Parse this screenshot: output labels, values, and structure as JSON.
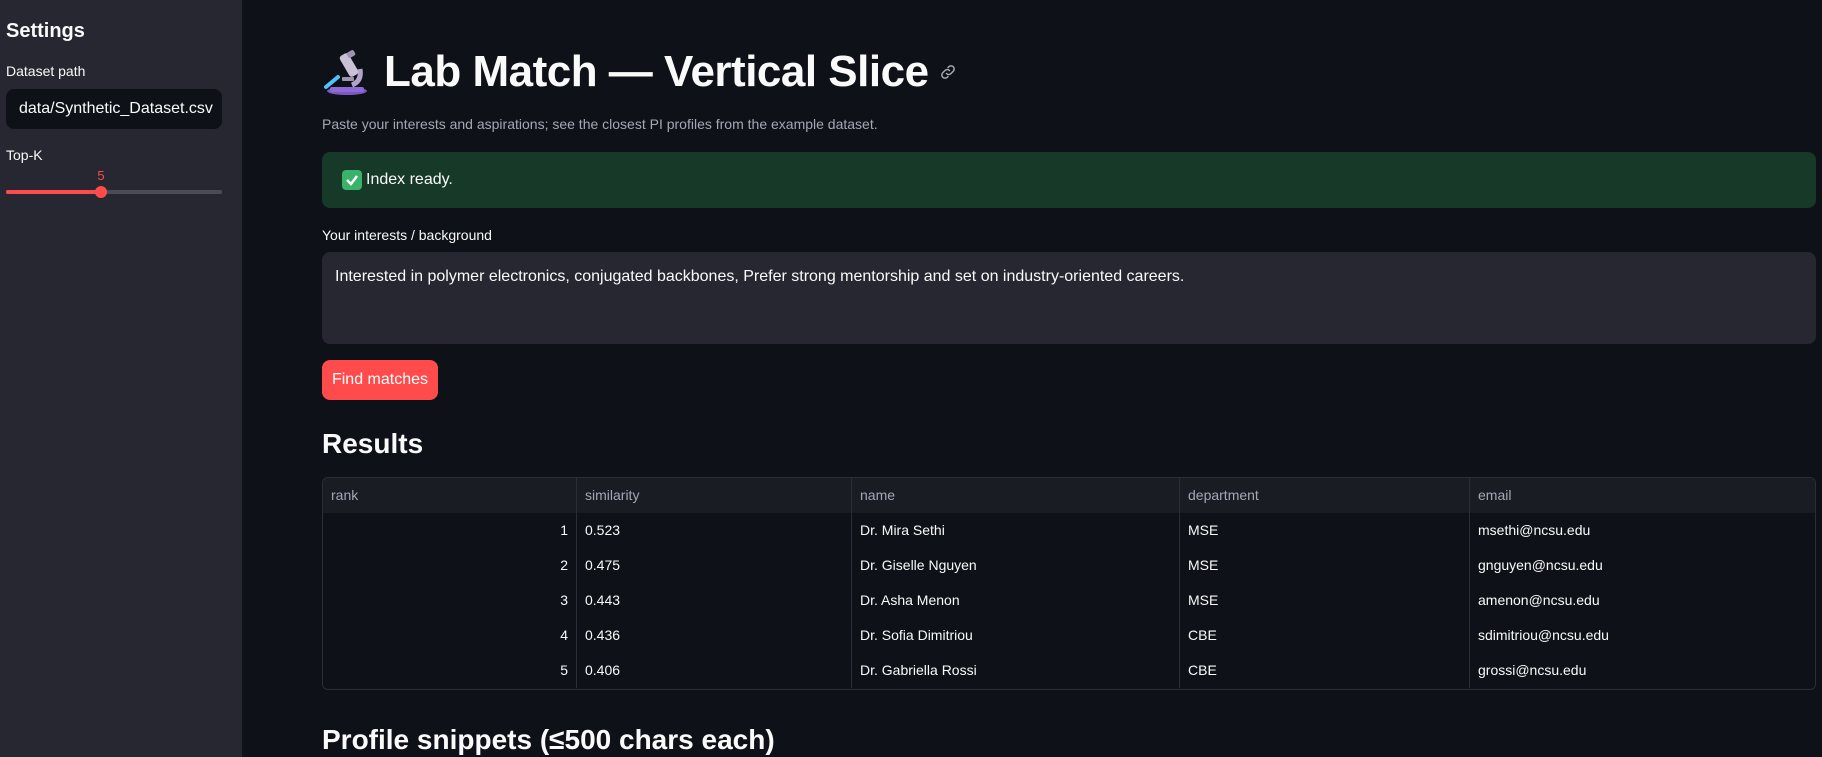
{
  "sidebar": {
    "title": "Settings",
    "dataset_label": "Dataset path",
    "dataset_value": "data/Synthetic_Dataset.csv",
    "topk_label": "Top-K",
    "topk_value": "5",
    "topk_fraction": 0.44
  },
  "main": {
    "title": "Lab Match — Vertical Slice",
    "caption": "Paste your interests and aspirations; see the closest PI profiles from the example dataset.",
    "alert_text": "Index ready.",
    "textarea_label": "Your interests / background",
    "textarea_value": "Interested in polymer electronics, conjugated backbones, Prefer strong mentorship and set on industry-oriented careers.",
    "button_label": "Find matches",
    "results_heading": "Results",
    "snippets_heading": "Profile snippets (≤500 chars each)"
  },
  "table": {
    "columns": [
      "rank",
      "similarity",
      "name",
      "department",
      "email"
    ],
    "rows": [
      [
        "1",
        "0.523",
        "Dr. Mira Sethi",
        "MSE",
        "msethi@ncsu.edu"
      ],
      [
        "2",
        "0.475",
        "Dr. Giselle Nguyen",
        "MSE",
        "gnguyen@ncsu.edu"
      ],
      [
        "3",
        "0.443",
        "Dr. Asha Menon",
        "MSE",
        "amenon@ncsu.edu"
      ],
      [
        "4",
        "0.436",
        "Dr. Sofia Dimitriou",
        "CBE",
        "sdimitriou@ncsu.edu"
      ],
      [
        "5",
        "0.406",
        "Dr. Gabriella Rossi",
        "CBE",
        "grossi@ncsu.edu"
      ]
    ]
  },
  "colors": {
    "accent": "#ff4b4b",
    "success_bg": "#173928",
    "sidebar_bg": "#262730",
    "page_bg": "#0e1117"
  },
  "icons": [
    "microscope-icon",
    "link-icon",
    "check-icon"
  ]
}
